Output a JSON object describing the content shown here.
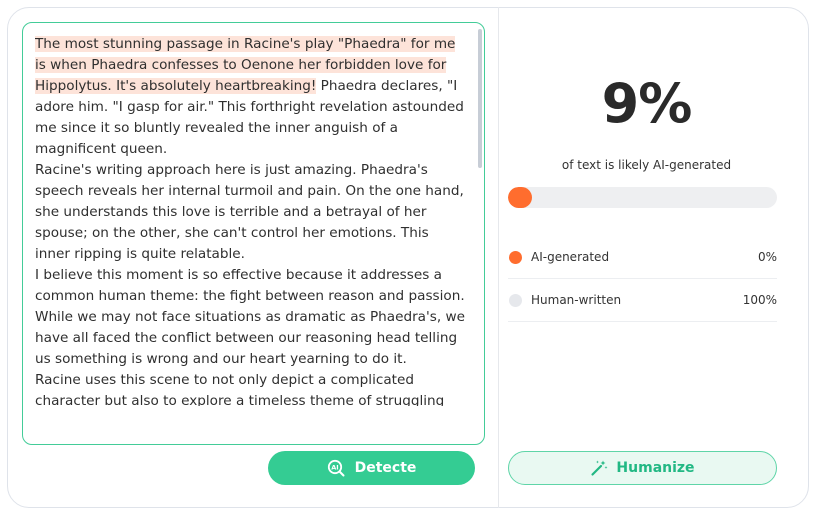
{
  "editor": {
    "highlighted_text": "The most stunning passage in Racine's play \"Phaedra\" for me is when Phaedra confesses to Oenone her forbidden love for Hippolytus. It's absolutely heartbreaking!",
    "p1_rest": " Phaedra declares, \"I adore him. \"I gasp for air.\" This forthright revelation astounded me since it so bluntly revealed the inner anguish of a magnificent queen.",
    "p2": "Racine's writing approach here is just amazing. Phaedra's speech reveals her internal turmoil and pain. On the one hand, she understands this love is terrible and a betrayal of her spouse; on the other, she can't control her emotions. This inner ripping is quite relatable.",
    "p3": "I believe this moment is so effective because it addresses a common human theme: the fight between reason and passion. While we may not face situations as dramatic as Phaedra's, we have all faced the conflict between our reasoning head telling us something is wrong and our heart yearning to do it.",
    "p4": "Racine uses this scene to not only depict a complicated character but also to explore a timeless theme of struggling with desire and morality that resonates even today."
  },
  "detect_button": {
    "label": "Detecte",
    "icon": "ai-scan-icon"
  },
  "result": {
    "percent_label": "9%",
    "ai_fraction": 0.09,
    "subtext": "of text is likely AI-generated",
    "legend": [
      {
        "label": "AI-generated",
        "value": "0%",
        "color": "#ff6d2e"
      },
      {
        "label": "Human-written",
        "value": "100%",
        "color": "#e6e8ec"
      }
    ]
  },
  "humanize_button": {
    "label": "Humanize",
    "icon": "magic-wand-icon"
  },
  "colors": {
    "accent_green": "#34cc93",
    "accent_orange": "#ff6d2e",
    "highlight": "#fde3d9"
  }
}
